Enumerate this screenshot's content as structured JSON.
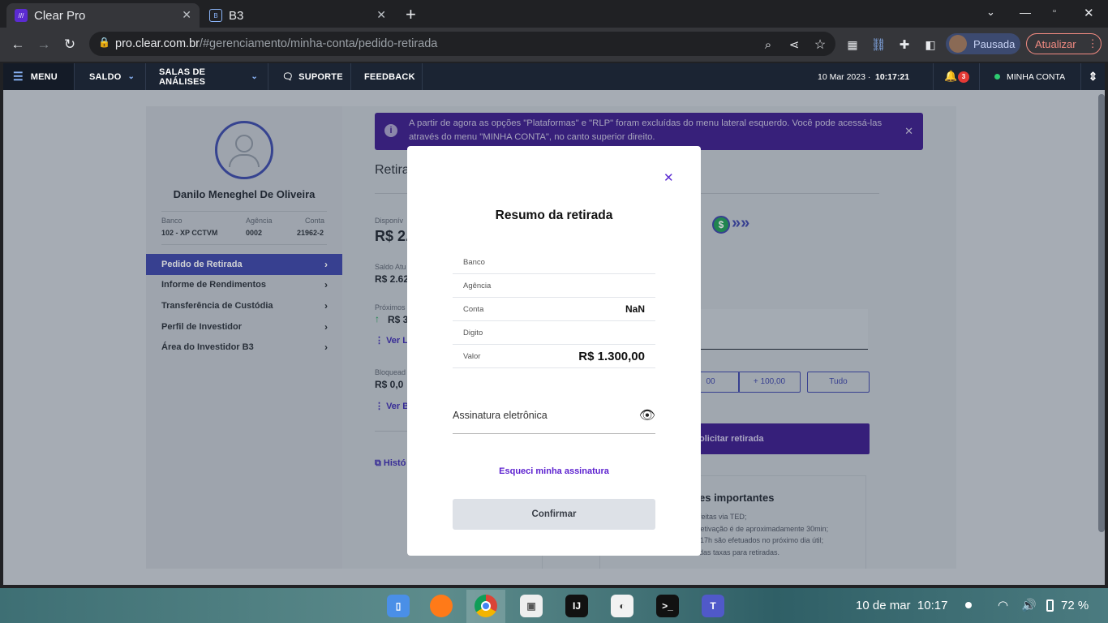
{
  "browser": {
    "tabs": [
      {
        "title": "Clear Pro",
        "favicon": "clear-icon"
      },
      {
        "title": "B3",
        "favicon": "b3-icon"
      }
    ],
    "url_domain": "pro.clear.com.br",
    "url_path": "/#gerenciamento/minha-conta/pedido-retirada",
    "profile_label": "Pausada",
    "update_label": "Atualizar"
  },
  "topnav": {
    "menu": "MENU",
    "saldo": "SALDO",
    "salas": "SALAS DE ANÁLISES",
    "suporte": "SUPORTE",
    "feedback": "FEEDBACK",
    "date": "10 Mar 2023 ·",
    "time": "10:17:21",
    "notif_count": "3",
    "account": "MINHA CONTA"
  },
  "profile": {
    "name": "Danilo Meneghel De Oliveira",
    "banco_label": "Banco",
    "banco": "102 - XP CCTVM",
    "agencia_label": "Agência",
    "agencia": "0002",
    "conta_label": "Conta",
    "conta": "21962-2",
    "menu": [
      "Pedido de Retirada",
      "Informe de Rendimentos",
      "Transferência de Custódia",
      "Perfil de Investidor",
      "Área do Investidor B3"
    ]
  },
  "main": {
    "banner": "A partir de agora as opções \"Plataformas\" e \"RLP\" foram excluídas do menu lateral esquerdo. Você pode acessá-las através do menu \"MINHA CONTA\", no canto superior direito.",
    "heading": "Retira",
    "disponivel_label": "Disponív",
    "disponivel": "R$ 2.",
    "saldo_label": "Saldo Atu",
    "saldo": "R$ 2.62",
    "proximos_label": "Próximos",
    "proximos": "R$ 3",
    "ver_lanc": "Ver La",
    "bloqueado_label": "Bloquead",
    "bloqueado": "R$ 0,0",
    "ver_bloq": "Ver Bl",
    "historico": "Histó",
    "quick_1": "00",
    "quick_2": "+ 100,00",
    "quick_3": "Tudo",
    "submit": "olicitar retirada",
    "info_title": "es importantes",
    "info_lines": [
      "feitas via TED;",
      "efetivação é de aproximadamente 30min;",
      "s 17h são efetuados no próximo dia útil;",
      "das taxas para retiradas."
    ]
  },
  "modal": {
    "title": "Resumo da retirada",
    "rows": [
      {
        "label": "Banco",
        "value": ""
      },
      {
        "label": "Agência",
        "value": ""
      },
      {
        "label": "Conta",
        "value": "NaN"
      },
      {
        "label": "Digito",
        "value": ""
      },
      {
        "label": "Valor",
        "value": "R$ 1.300,00"
      }
    ],
    "signature_placeholder": "Assinatura eletrônica",
    "forgot": "Esqueci minha assinatura",
    "confirm": "Confirmar"
  },
  "taskbar": {
    "date": "10 de mar",
    "time": "10:17",
    "battery": "72 %"
  },
  "colors": {
    "accent": "#5b1fcf",
    "nav": "#1b2433",
    "selected_menu": "#3c44a8",
    "notif_badge": "#e53935",
    "online_dot": "#2ecc71"
  }
}
